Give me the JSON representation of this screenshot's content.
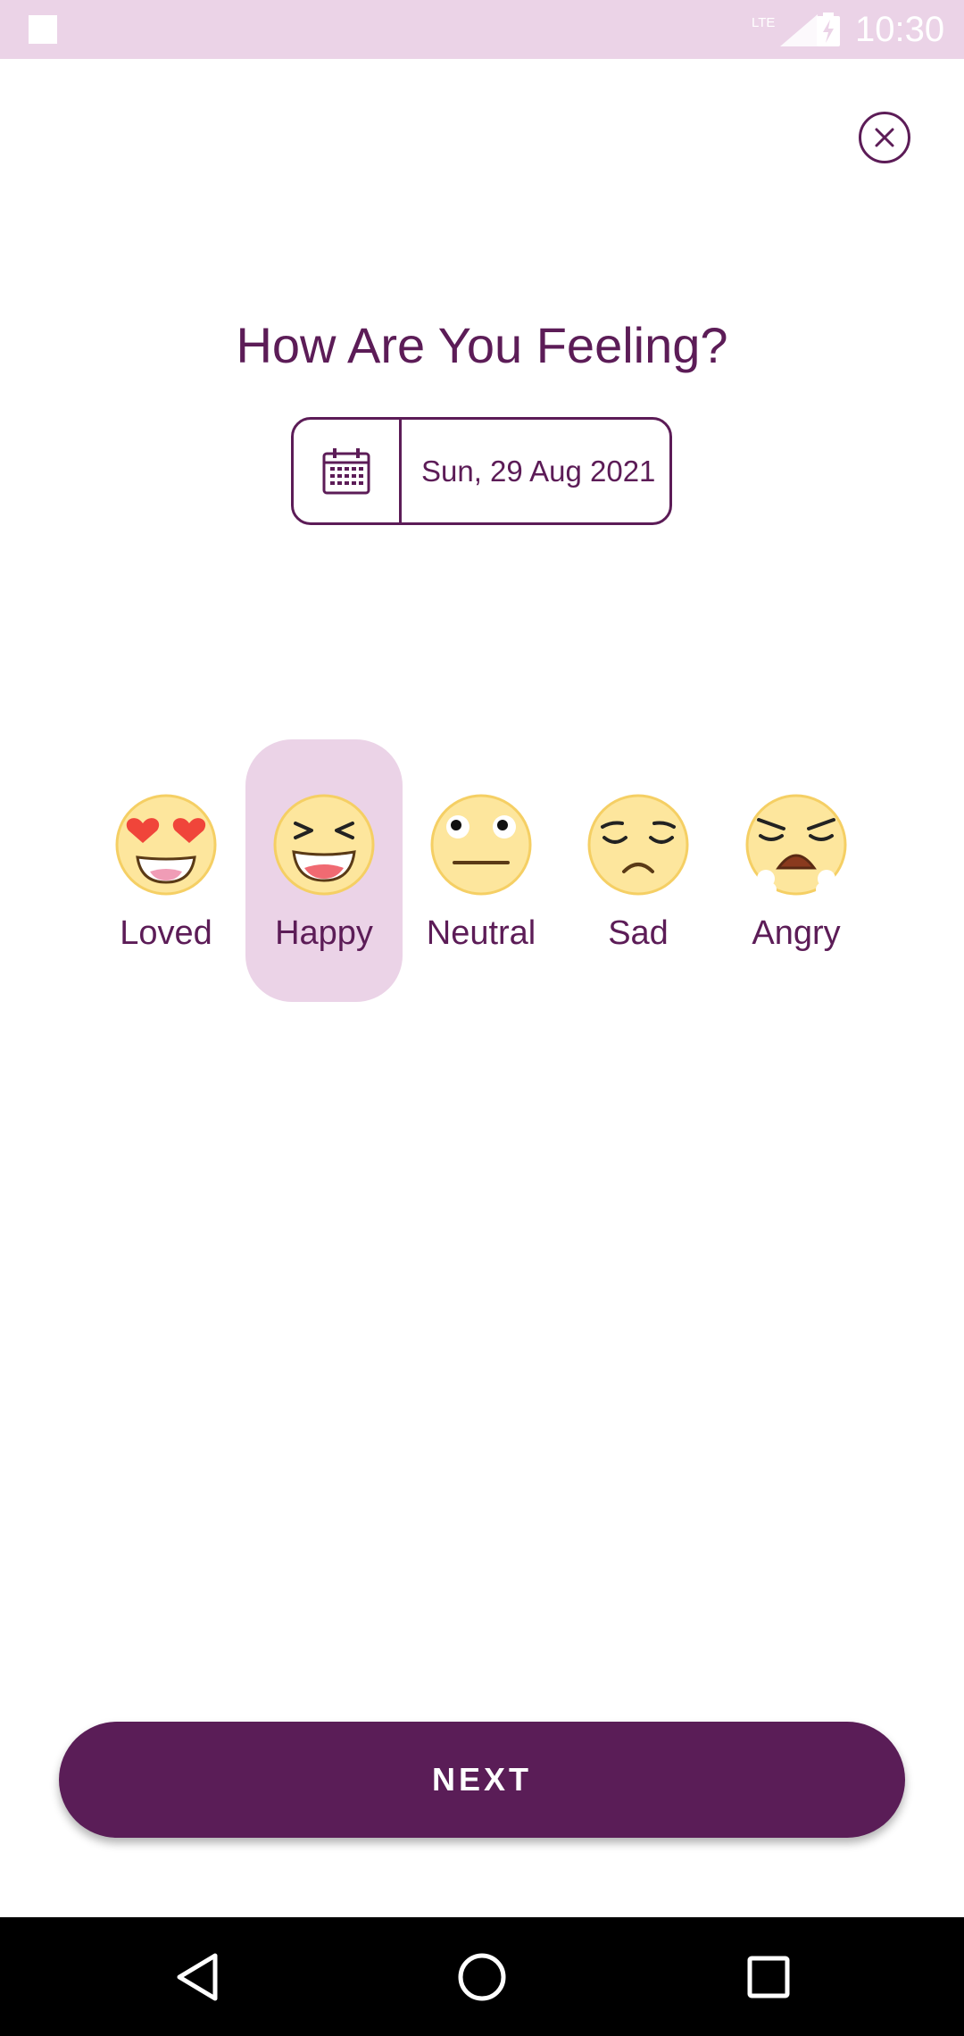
{
  "status_bar": {
    "time": "10:30",
    "network_label": "LTE",
    "icons": [
      "notification-square-icon",
      "signal-icon",
      "battery-charging-icon"
    ],
    "background": "#ebd3e7"
  },
  "header": {
    "close_icon": "close-circle-icon"
  },
  "main": {
    "title": "How Are You Feeling?",
    "date": {
      "icon": "calendar-icon",
      "value": "Sun, 29 Aug 2021"
    },
    "moods": [
      {
        "label": "Loved",
        "icon": "heart-eyes-emoji-icon",
        "selected": false
      },
      {
        "label": "Happy",
        "icon": "laughing-emoji-icon",
        "selected": true
      },
      {
        "label": "Neutral",
        "icon": "neutral-emoji-icon",
        "selected": false
      },
      {
        "label": "Sad",
        "icon": "sad-emoji-icon",
        "selected": false
      },
      {
        "label": "Angry",
        "icon": "angry-emoji-icon",
        "selected": false
      }
    ]
  },
  "footer": {
    "next_label": "NEXT"
  },
  "nav_bar": {
    "icons": [
      "back-triangle-icon",
      "home-circle-icon",
      "recents-square-icon"
    ]
  },
  "colors": {
    "primary": "#5c1c57",
    "highlight": "#ebd3e7",
    "button": "#5a1d57",
    "emoji_face": "#fde69d",
    "emoji_rim": "#f5cf64"
  }
}
